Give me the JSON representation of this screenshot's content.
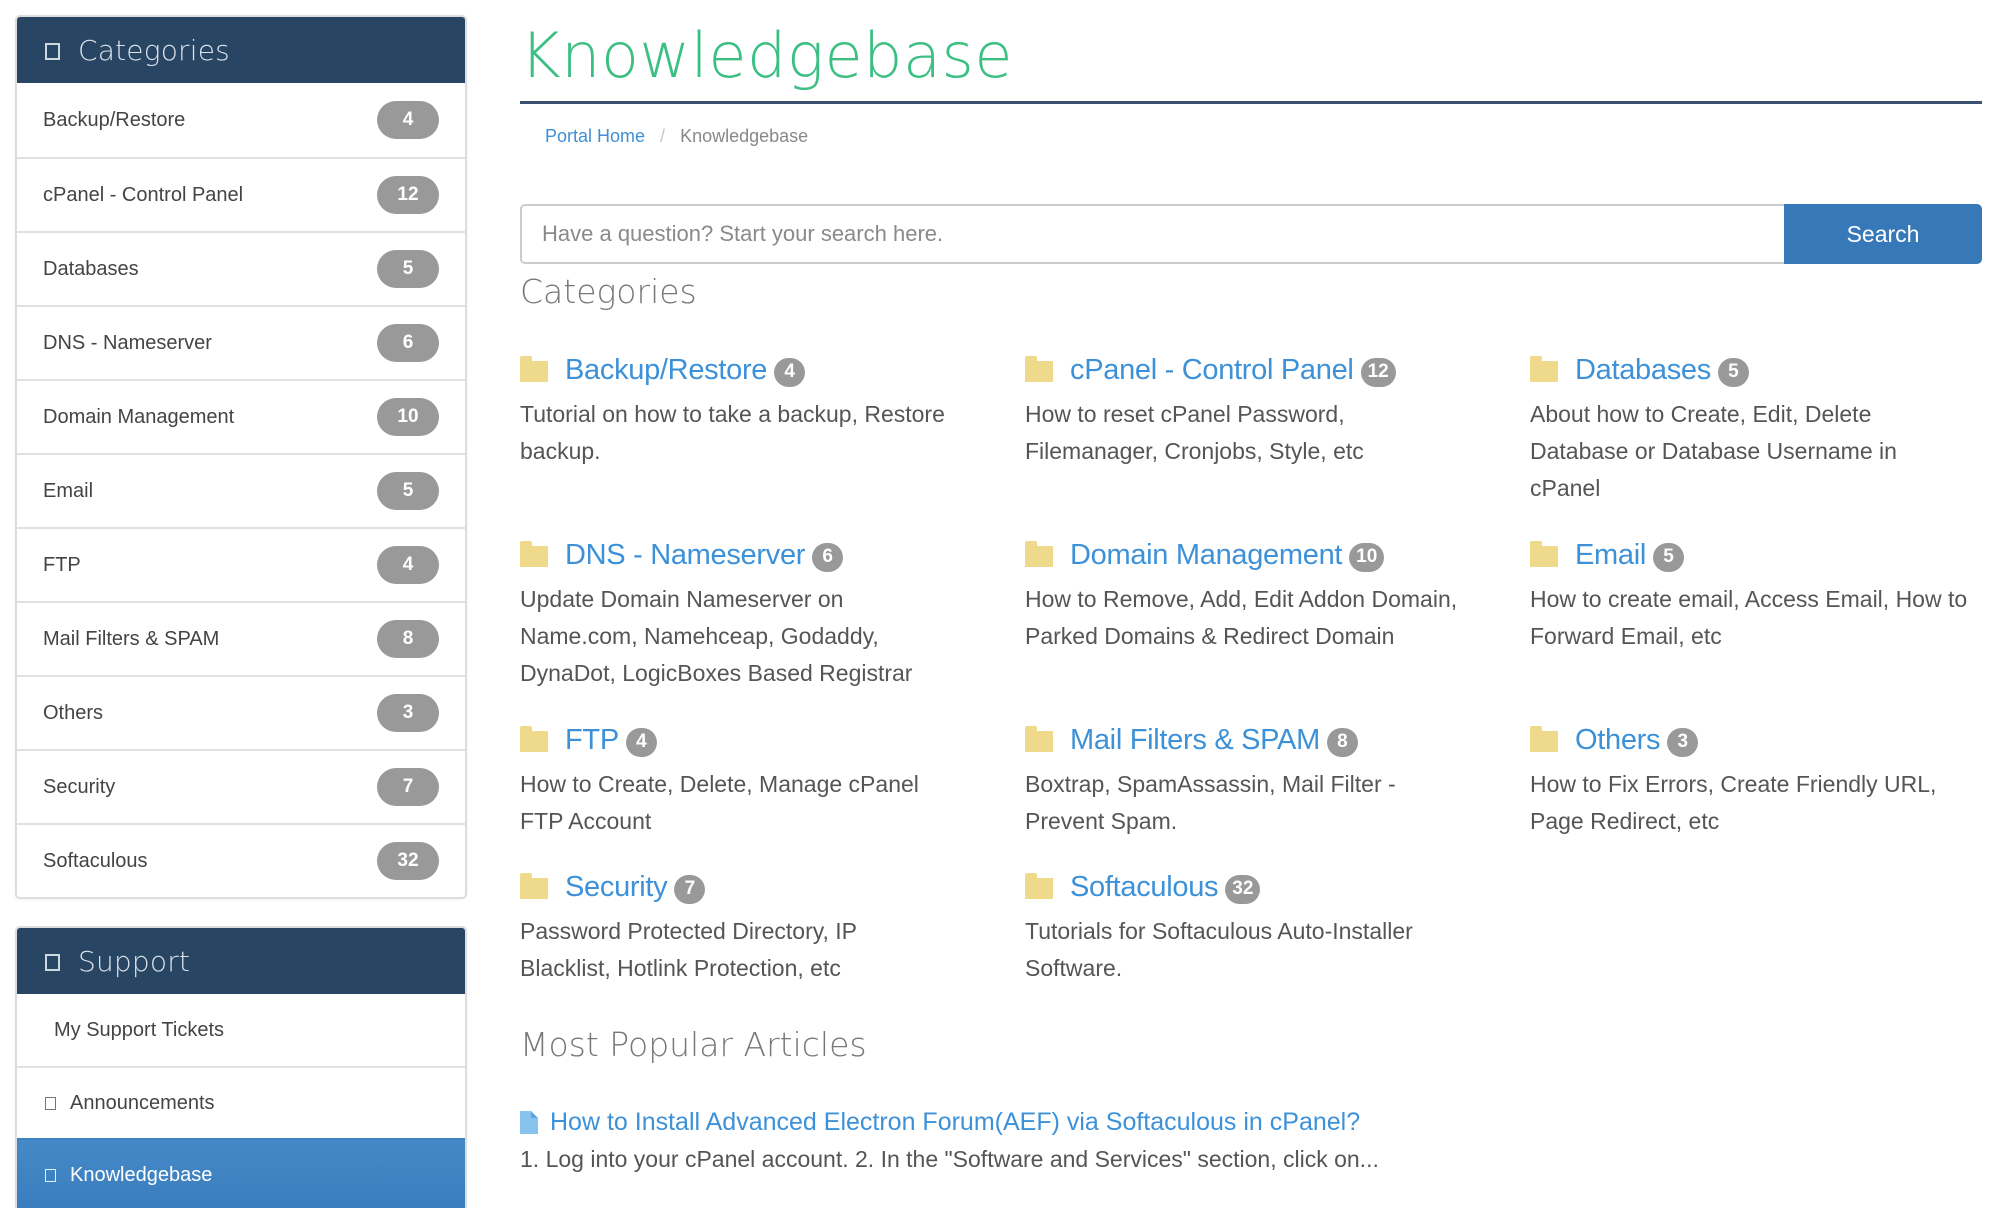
{
  "sidebar": {
    "categories_panel": {
      "title": "Categories",
      "icon": "square-outline-icon",
      "items": [
        {
          "label": "Backup/Restore",
          "count": "4"
        },
        {
          "label": "cPanel - Control Panel",
          "count": "12"
        },
        {
          "label": "Databases",
          "count": "5"
        },
        {
          "label": "DNS - Nameserver",
          "count": "6"
        },
        {
          "label": "Domain Management",
          "count": "10"
        },
        {
          "label": "Email",
          "count": "5"
        },
        {
          "label": "FTP",
          "count": "4"
        },
        {
          "label": "Mail Filters & SPAM",
          "count": "8"
        },
        {
          "label": "Others",
          "count": "3"
        },
        {
          "label": "Security",
          "count": "7"
        },
        {
          "label": "Softaculous",
          "count": "32"
        }
      ]
    },
    "support_panel": {
      "title": "Support",
      "icon": "square-outline-icon",
      "items": [
        {
          "label": "My Support Tickets",
          "icon": null,
          "active": false
        },
        {
          "label": "Announcements",
          "icon": "square-outline-icon",
          "active": false
        },
        {
          "label": "Knowledgebase",
          "icon": "square-outline-icon",
          "active": true
        }
      ]
    }
  },
  "header": {
    "title": "Knowledgebase",
    "breadcrumb": [
      {
        "label": "Portal Home",
        "link": true
      },
      {
        "label": "Knowledgebase",
        "link": false
      }
    ],
    "breadcrumb_separator": "/"
  },
  "search": {
    "placeholder": "Have a question? Start your search here.",
    "value": "",
    "button_label": "Search"
  },
  "categories": {
    "heading": "Categories",
    "items": [
      {
        "name": "Backup/Restore",
        "count": "4",
        "description": "Tutorial on how to take a backup, Restore backup."
      },
      {
        "name": "cPanel - Control Panel",
        "count": "12",
        "description": "How to reset cPanel Password, Filemanager, Cronjobs, Style, etc"
      },
      {
        "name": "Databases",
        "count": "5",
        "description": "About how to Create, Edit, Delete Database or Database Username in cPanel"
      },
      {
        "name": "DNS - Nameserver",
        "count": "6",
        "description": "Update Domain Nameserver on Name.com, Namehceap, Godaddy, DynaDot, LogicBoxes Based Registrar"
      },
      {
        "name": "Domain Management",
        "count": "10",
        "description": "How to Remove, Add, Edit Addon Domain, Parked Domains & Redirect Domain"
      },
      {
        "name": "Email",
        "count": "5",
        "description": "How to create email, Access Email, How to Forward Email, etc"
      },
      {
        "name": "FTP",
        "count": "4",
        "description": "How to Create, Delete, Manage cPanel FTP Account"
      },
      {
        "name": "Mail Filters & SPAM",
        "count": "8",
        "description": "Boxtrap, SpamAssassin, Mail Filter - Prevent Spam."
      },
      {
        "name": "Others",
        "count": "3",
        "description": "How to Fix Errors, Create Friendly URL, Page Redirect, etc"
      },
      {
        "name": "Security",
        "count": "7",
        "description": "Password Protected Directory, IP Blacklist, Hotlink Protection, etc"
      },
      {
        "name": "Softaculous",
        "count": "32",
        "description": "Tutorials for Softaculous Auto-Installer Software."
      }
    ]
  },
  "popular": {
    "heading": "Most Popular Articles",
    "articles": [
      {
        "title": "How to Install Advanced Electron Forum(AEF) via Softaculous in cPanel?",
        "excerpt": "1. Log into your cPanel account. 2. In the \"Software and Services\" section, click on..."
      }
    ]
  },
  "colors": {
    "sidebar_header_bg": "#284664",
    "title_green": "#3cbf82",
    "link_blue": "#3c91d8",
    "search_button": "#3779b8",
    "badge_grey": "#999999",
    "folder_yellow": "#efd98a",
    "active_item": "#4589c7"
  }
}
